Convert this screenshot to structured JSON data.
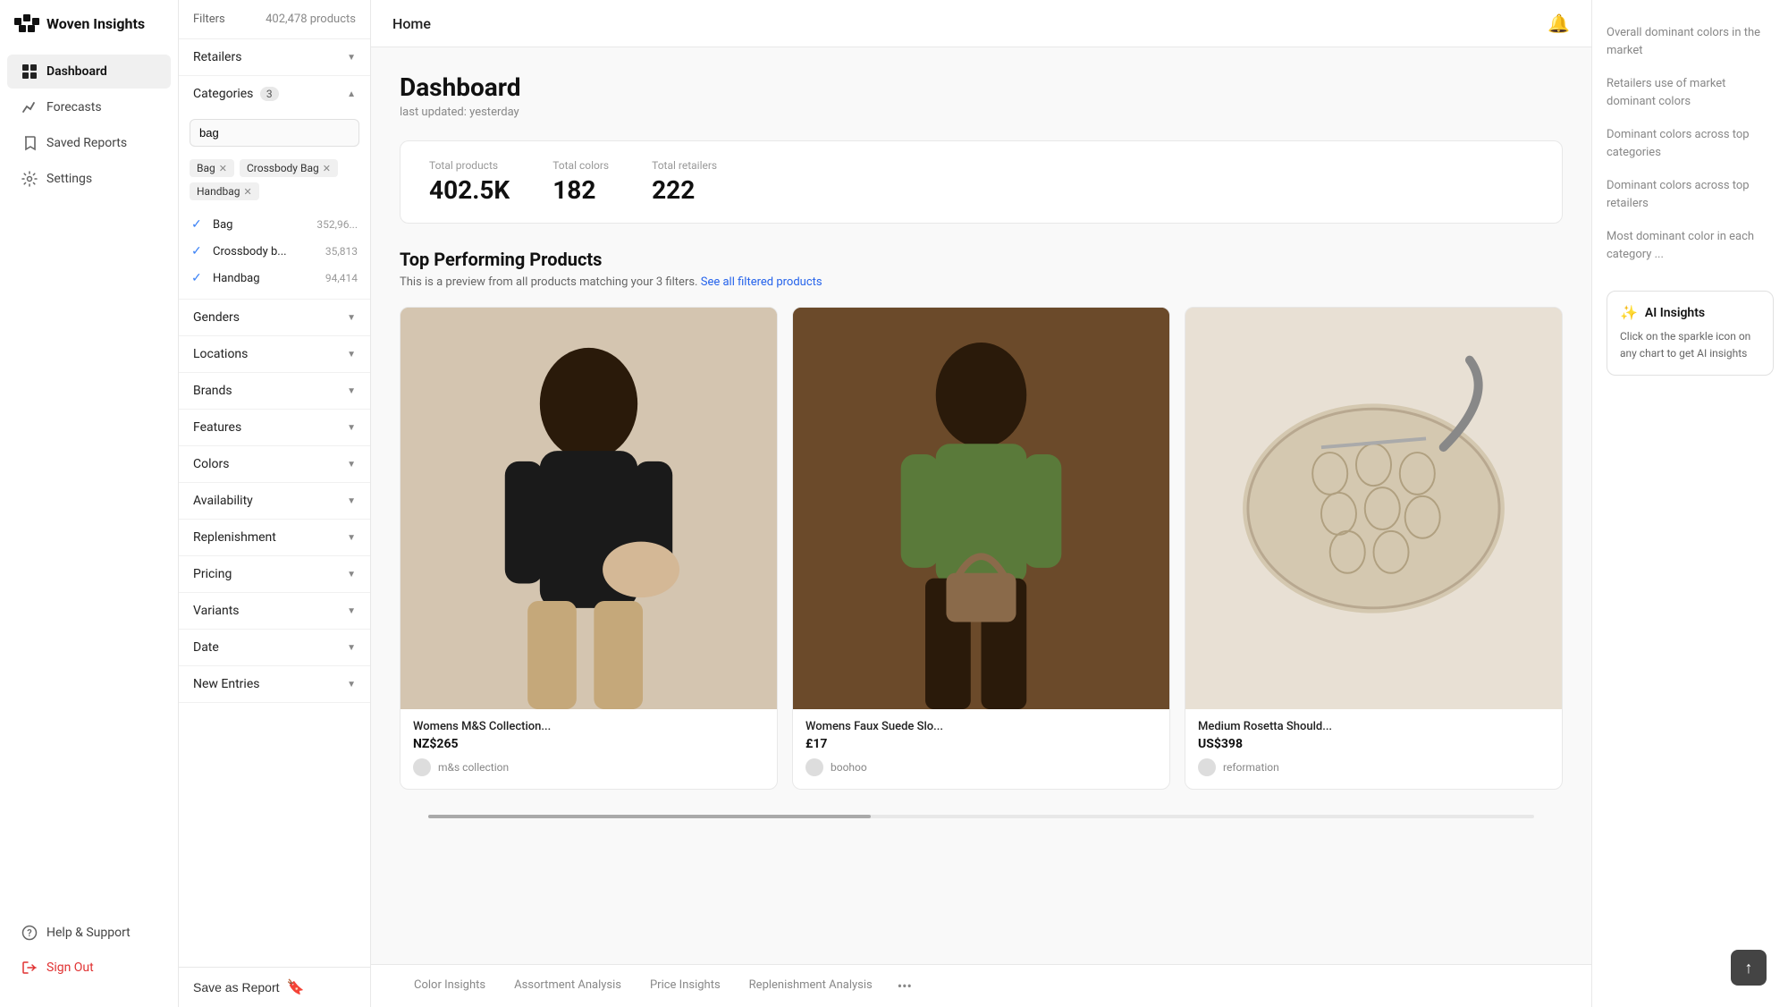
{
  "app": {
    "name": "Woven Insights"
  },
  "nav": {
    "items": [
      {
        "id": "dashboard",
        "label": "Dashboard",
        "icon": "grid",
        "active": true
      },
      {
        "id": "forecasts",
        "label": "Forecasts",
        "icon": "chart"
      },
      {
        "id": "saved-reports",
        "label": "Saved Reports",
        "icon": "bookmark"
      },
      {
        "id": "settings",
        "label": "Settings",
        "icon": "gear"
      }
    ],
    "bottom": [
      {
        "id": "help",
        "label": "Help & Support",
        "icon": "help"
      },
      {
        "id": "sign-out",
        "label": "Sign Out",
        "icon": "logout",
        "accent": true
      }
    ]
  },
  "filters": {
    "label": "Filters",
    "product_count": "402,478 products",
    "sections": [
      {
        "id": "retailers",
        "label": "Retailers",
        "expanded": false
      },
      {
        "id": "categories",
        "label": "Categories",
        "badge": "3",
        "expanded": true
      },
      {
        "id": "genders",
        "label": "Genders",
        "expanded": false
      },
      {
        "id": "locations",
        "label": "Locations",
        "expanded": false
      },
      {
        "id": "brands",
        "label": "Brands",
        "expanded": false
      },
      {
        "id": "features",
        "label": "Features",
        "expanded": false
      },
      {
        "id": "colors",
        "label": "Colors",
        "expanded": false
      },
      {
        "id": "availability",
        "label": "Availability",
        "expanded": false
      },
      {
        "id": "replenishment",
        "label": "Replenishment",
        "expanded": false
      },
      {
        "id": "pricing",
        "label": "Pricing",
        "expanded": false
      },
      {
        "id": "variants",
        "label": "Variants",
        "expanded": false
      },
      {
        "id": "date",
        "label": "Date",
        "expanded": false
      },
      {
        "id": "new-entries",
        "label": "New Entries",
        "expanded": false
      }
    ],
    "category_search_placeholder": "bag",
    "selected_tags": [
      "Bag",
      "Crossbody Bag",
      "Handbag"
    ],
    "category_items": [
      {
        "label": "Bag",
        "count": "352,96...",
        "checked": true
      },
      {
        "label": "Crossbody b...",
        "count": "35,813",
        "checked": true
      },
      {
        "label": "Handbag",
        "count": "94,414",
        "checked": true
      }
    ],
    "save_report_label": "Save as Report"
  },
  "topbar": {
    "home_label": "Home",
    "notification_icon": "bell"
  },
  "dashboard": {
    "title": "Dashboard",
    "subtitle": "last updated: yesterday",
    "stats": {
      "total_products_label": "Total products",
      "total_products_value": "402.5K",
      "total_colors_label": "Total colors",
      "total_colors_value": "182",
      "total_retailers_label": "Total retailers",
      "total_retailers_value": "222"
    },
    "top_products": {
      "title": "Top Performing Products",
      "subtitle": "This is a preview from all products matching your 3 filters.",
      "see_all_link": "See all filtered products",
      "products": [
        {
          "name": "Womens M&S Collection...",
          "price": "NZ$265",
          "retailer": "m&s collection",
          "img_color": "beige"
        },
        {
          "name": "Womens Faux Suede Slo...",
          "price": "£17",
          "retailer": "boohoo",
          "img_color": "brown"
        },
        {
          "name": "Medium Rosetta Should...",
          "price": "US$398",
          "retailer": "reformation",
          "img_color": "cream"
        }
      ]
    },
    "bottom_tabs": [
      {
        "id": "color-insights",
        "label": "Color Insights",
        "active": false
      },
      {
        "id": "assortment-analysis",
        "label": "Assortment Analysis",
        "active": false
      },
      {
        "id": "price-insights",
        "label": "Price Insights",
        "active": false
      },
      {
        "id": "replenishment-analysis",
        "label": "Replenishment Analysis",
        "active": false
      }
    ]
  },
  "right_panel": {
    "links": [
      "Overall dominant colors in the market",
      "Retailers use of market dominant colors",
      "Dominant colors across top categories",
      "Dominant colors across top retailers",
      "Most dominant color in each category ..."
    ],
    "ai_insights": {
      "title": "AI Insights",
      "text": "Click on the sparkle icon on any chart to get AI insights"
    }
  }
}
